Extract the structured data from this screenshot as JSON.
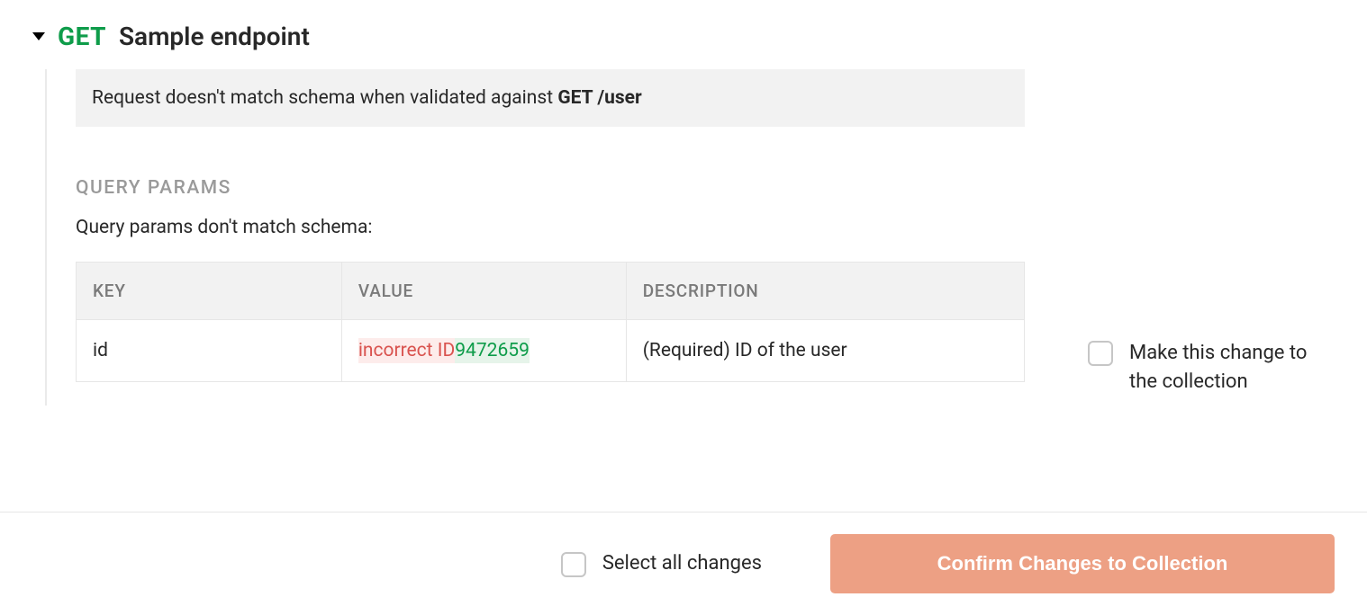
{
  "endpoint": {
    "method": "GET",
    "name": "Sample endpoint"
  },
  "banner": {
    "prefix": "Request doesn't match schema when validated against ",
    "strong": "GET /user"
  },
  "section": {
    "title": "QUERY PARAMS",
    "subtitle": "Query params don't match schema:"
  },
  "table": {
    "headers": {
      "key": "KEY",
      "value": "VALUE",
      "description": "DESCRIPTION"
    },
    "rows": [
      {
        "key": "id",
        "value_old": "incorrect ID",
        "value_new": "9472659",
        "description": "(Required) ID of the user"
      }
    ]
  },
  "side_action": {
    "label": "Make this change to the collection"
  },
  "footer": {
    "select_all": "Select all changes",
    "confirm": "Confirm Changes to Collection"
  }
}
